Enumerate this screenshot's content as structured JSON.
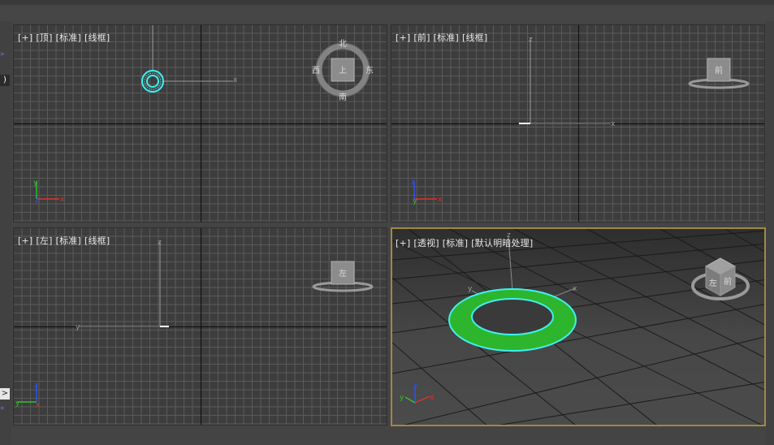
{
  "viewports": {
    "top": {
      "labels": [
        "[+]",
        "[顶]",
        "[标准]",
        "[线框]"
      ],
      "nav_labels": {
        "north": "北",
        "south": "南",
        "east": "东",
        "west": "西",
        "face": "上"
      }
    },
    "front": {
      "labels": [
        "[+]",
        "[前]",
        "[标准]",
        "[线框]"
      ],
      "nav_labels": {
        "face": "前"
      }
    },
    "left": {
      "labels": [
        "[+]",
        "[左]",
        "[标准]",
        "[线框]"
      ],
      "nav_labels": {
        "face": "左"
      }
    },
    "perspective": {
      "labels": [
        "[+]",
        "[透视]",
        "[标准]",
        "[默认明暗处理]"
      ],
      "nav_labels": {
        "face": "前",
        "side": "左"
      }
    }
  },
  "axes": {
    "x": "x",
    "y": "y",
    "z": "z"
  },
  "left_panel": {
    "toggle_top": ")",
    "expand_bottom": ">",
    "collapse_marks": "»"
  },
  "colors": {
    "x_axis": "#e03030",
    "y_axis": "#30c030",
    "z_axis": "#3050f0",
    "selection": "#40f0f0",
    "torus_fill": "#2db52d",
    "active_border": "#a08846"
  }
}
